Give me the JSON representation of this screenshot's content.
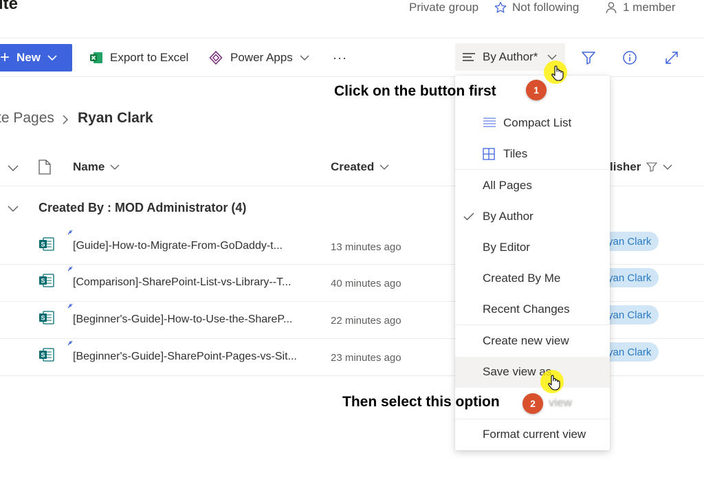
{
  "header": {
    "site_title": "ite",
    "privacy": "Private group",
    "follow": "Not following",
    "members": "1 member"
  },
  "command_bar": {
    "new_label": "New",
    "export_label": "Export to Excel",
    "powerapps_label": "Power Apps",
    "more_label": "···",
    "view_label": "By Author*"
  },
  "breadcrumb": {
    "parent": "te Pages",
    "separator": ">",
    "current": "Ryan Clark"
  },
  "columns": {
    "name": "Name",
    "created": "Created",
    "publisher": "lisher"
  },
  "group": {
    "label": "Created By : MOD Administrator (4)"
  },
  "rows": [
    {
      "name": "[Guide]-How-to-Migrate-From-GoDaddy-t...",
      "created": "13 minutes ago",
      "publisher": "yan Clark"
    },
    {
      "name": "[Comparison]-SharePoint-List-vs-Library--T...",
      "created": "40 minutes ago",
      "publisher": "yan Clark"
    },
    {
      "name": "[Beginner's-Guide]-How-to-Use-the-ShareP...",
      "created": "22 minutes ago",
      "publisher": "yan Clark"
    },
    {
      "name": "[Beginner's-Guide]-SharePoint-Pages-vs-Sit...",
      "created": "23 minutes ago",
      "publisher": "yan Clark"
    }
  ],
  "view_menu": {
    "compact_list": "Compact List",
    "tiles": "Tiles",
    "all_pages": "All Pages",
    "by_author": "By Author",
    "by_editor": "By Editor",
    "created_by_me": "Created By Me",
    "recent_changes": "Recent Changes",
    "create_new_view": "Create new view",
    "save_view_as": "Save view as",
    "hidden_item": "view",
    "format_current_view": "Format current view"
  },
  "annotations": {
    "step1_text": "Click on the button first",
    "step1_num": "1",
    "step2_text": "Then select this option",
    "step2_num": "2"
  },
  "colors": {
    "primary": "#3d63dd",
    "badge": "#d9512c",
    "pill_bg": "#d0e6f7",
    "cursor_highlight": "#fff000"
  }
}
